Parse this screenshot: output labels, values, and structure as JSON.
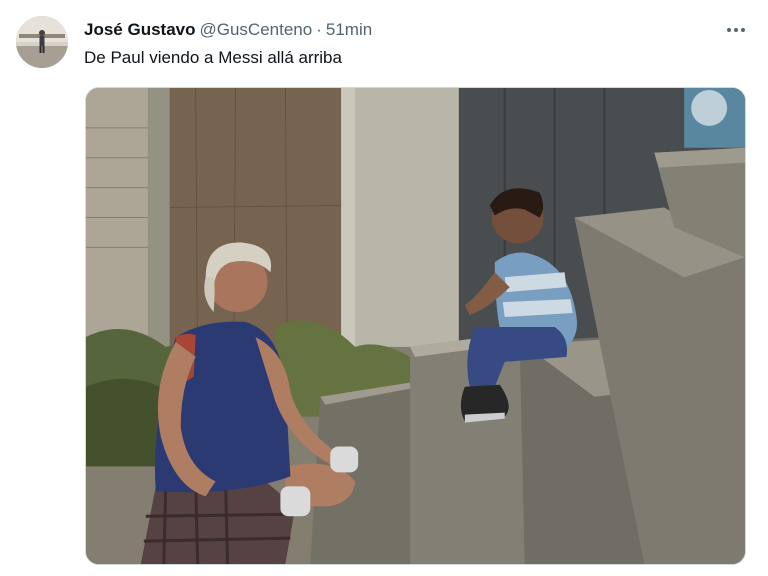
{
  "tweet": {
    "author_name": "José Gustavo",
    "handle": "@GusCenteno",
    "separator": "·",
    "time_ago": "51min",
    "text": "De Paul viendo a Messi allá arriba"
  },
  "icons": {
    "more": "more-horizontal-icon"
  },
  "colors": {
    "text_primary": "#0f1419",
    "text_secondary": "#536471",
    "media_border": "#cfd9de"
  }
}
